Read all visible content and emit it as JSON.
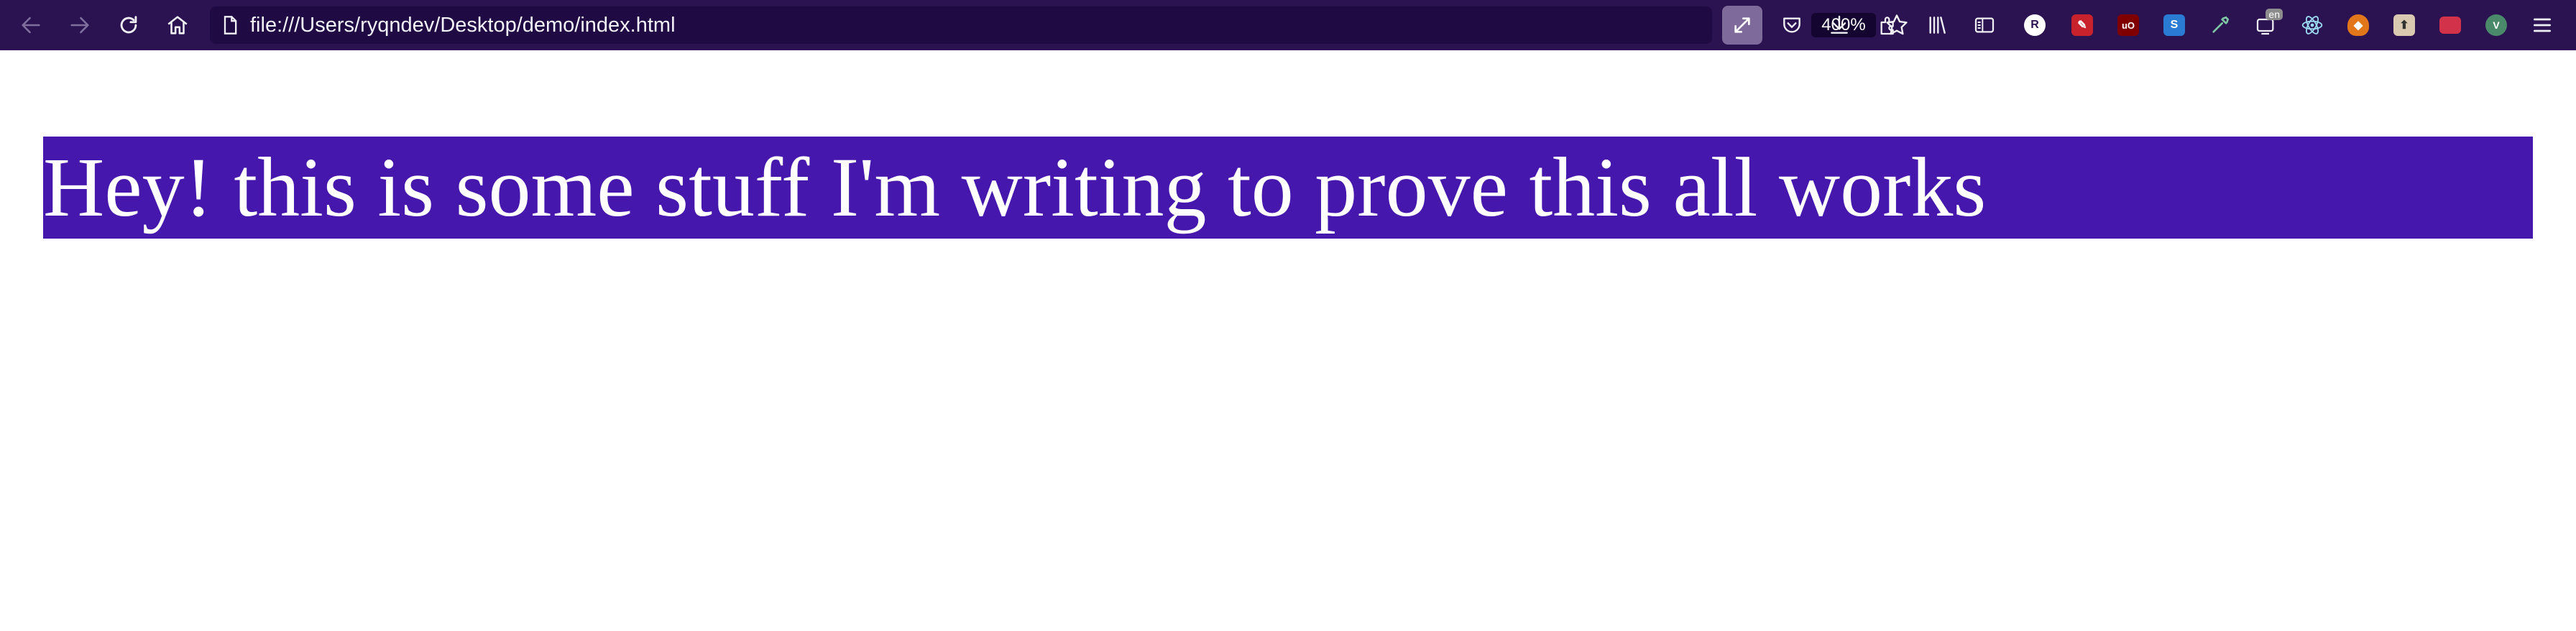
{
  "browser": {
    "url": "file:///Users/ryqndev/Desktop/demo/index.html",
    "zoom": "400%",
    "extension_badge": "en",
    "toolbar_icons": [
      "back-icon",
      "forward-icon",
      "reload-icon",
      "home-icon",
      "page-icon",
      "bookmark-star-icon",
      "fullscreen-icon",
      "pocket-icon",
      "download-icon",
      "extensions-icon",
      "library-icon",
      "sidebar-icon",
      "extension-r-icon",
      "extension-red-pen-icon",
      "extension-ublock-icon",
      "extension-s-icon",
      "extension-dropper-icon",
      "extension-translate-icon",
      "extension-react-icon",
      "extension-metamask-icon",
      "extension-save-icon",
      "extension-folder-icon",
      "extension-vue-icon",
      "menu-icon"
    ]
  },
  "page": {
    "headline": "Hey! this is some stuff I'm writing to prove this all works",
    "headline_bg": "#4517ac",
    "headline_color": "#ffffff"
  },
  "colors": {
    "toolbar_bg": "#2b1250",
    "urlbar_bg": "#1f0a43"
  }
}
